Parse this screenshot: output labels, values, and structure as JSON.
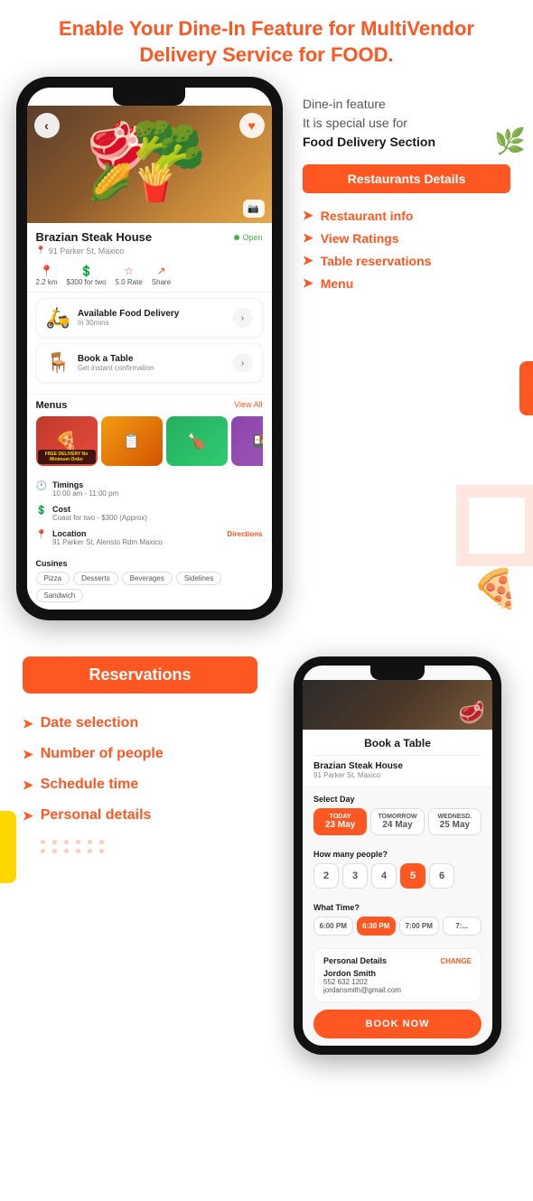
{
  "header": {
    "title": "Enable Your Dine-In Feature for MultiVendor Delivery Service for FOOD."
  },
  "right_panel": {
    "dine_desc_line1": "Dine-in feature",
    "dine_desc_line2": "It is special use for",
    "dine_desc_line3": "Food Delivery Section",
    "section_label": "Restaurants Details",
    "features": [
      "Restaurant info",
      "View Ratings",
      "Table reservations",
      "Menu"
    ]
  },
  "phone1": {
    "restaurant": {
      "name": "Brazian Steak House",
      "status": "Open",
      "address": "91 Parker St, Maxico",
      "distance": "2.2 km",
      "cost": "$300 for two",
      "rate": "5.0 Rate",
      "share": "Share"
    },
    "delivery_card": {
      "title": "Available Food Delivery",
      "subtitle": "In 30mins"
    },
    "table_card": {
      "title": "Book a Table",
      "subtitle": "Get instant confirmation"
    },
    "menus": {
      "title": "Menus",
      "view_all": "View All"
    },
    "details": {
      "timings_label": "Timings",
      "timings_value": "10:00 am - 11:00 pm",
      "cost_label": "Cost",
      "cost_value": "Coast for two - $300 (Approx)",
      "location_label": "Location",
      "location_value": "91 Parker St, Alensto Rdm Maxico",
      "directions": "Directions"
    },
    "cuisines": {
      "title": "Cusines",
      "tags": [
        "Pizza",
        "Desserts",
        "Beverages",
        "Sidelines",
        "Sandwich"
      ]
    }
  },
  "phone2": {
    "booking_title": "Book a Table",
    "rest_name": "Brazian Steak House",
    "rest_addr": "91 Parker St, Maxico",
    "select_day_label": "Select Day",
    "days": [
      {
        "label": "TODAY",
        "num": "23 May",
        "active": true
      },
      {
        "label": "TOMORROW",
        "num": "24 May",
        "active": false
      },
      {
        "label": "WEDNESD.",
        "num": "25 May",
        "active": false
      }
    ],
    "people_label": "How many people?",
    "people_options": [
      {
        "val": "2",
        "active": false
      },
      {
        "val": "3",
        "active": false
      },
      {
        "val": "4",
        "active": false
      },
      {
        "val": "5",
        "active": true
      },
      {
        "val": "6",
        "active": false
      }
    ],
    "time_label": "What Time?",
    "time_options": [
      {
        "val": "6:00 PM",
        "active": false
      },
      {
        "val": "6:30 PM",
        "active": true
      },
      {
        "val": "7:00 PM",
        "active": false
      },
      {
        "val": "7:...",
        "active": false
      }
    ],
    "personal_details": {
      "title": "Personal Details",
      "change": "CHANGE",
      "name": "Jordon Smith",
      "phone": "552 632 1202",
      "email": "jordansmith@gmail.com"
    },
    "book_now": "BOOK NOW"
  },
  "bottom_panel": {
    "section_label": "Reservations",
    "features": [
      "Date selection",
      "Number of people",
      "Schedule time",
      "Personal details"
    ]
  }
}
